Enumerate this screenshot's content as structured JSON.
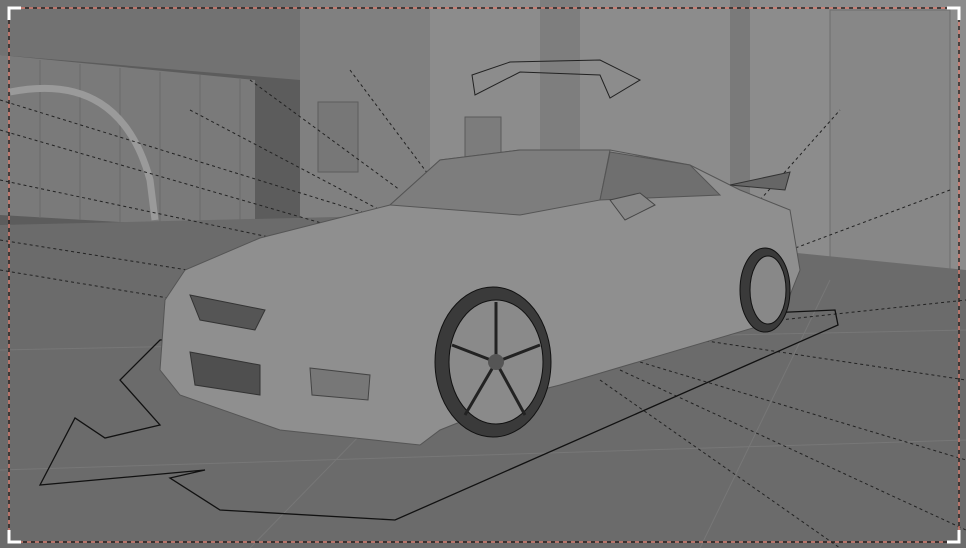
{
  "viewport": {
    "mode": "camera-view",
    "colors": {
      "background": "#5e5e5e",
      "wall": "#8a8a8a",
      "floor": "#6c6c6c",
      "car_body": "#8e8e8e",
      "frame_border": "#e87a6a",
      "frame_corner": "#ffffff"
    },
    "icons": [
      "camera-frame-corner-icon"
    ]
  }
}
